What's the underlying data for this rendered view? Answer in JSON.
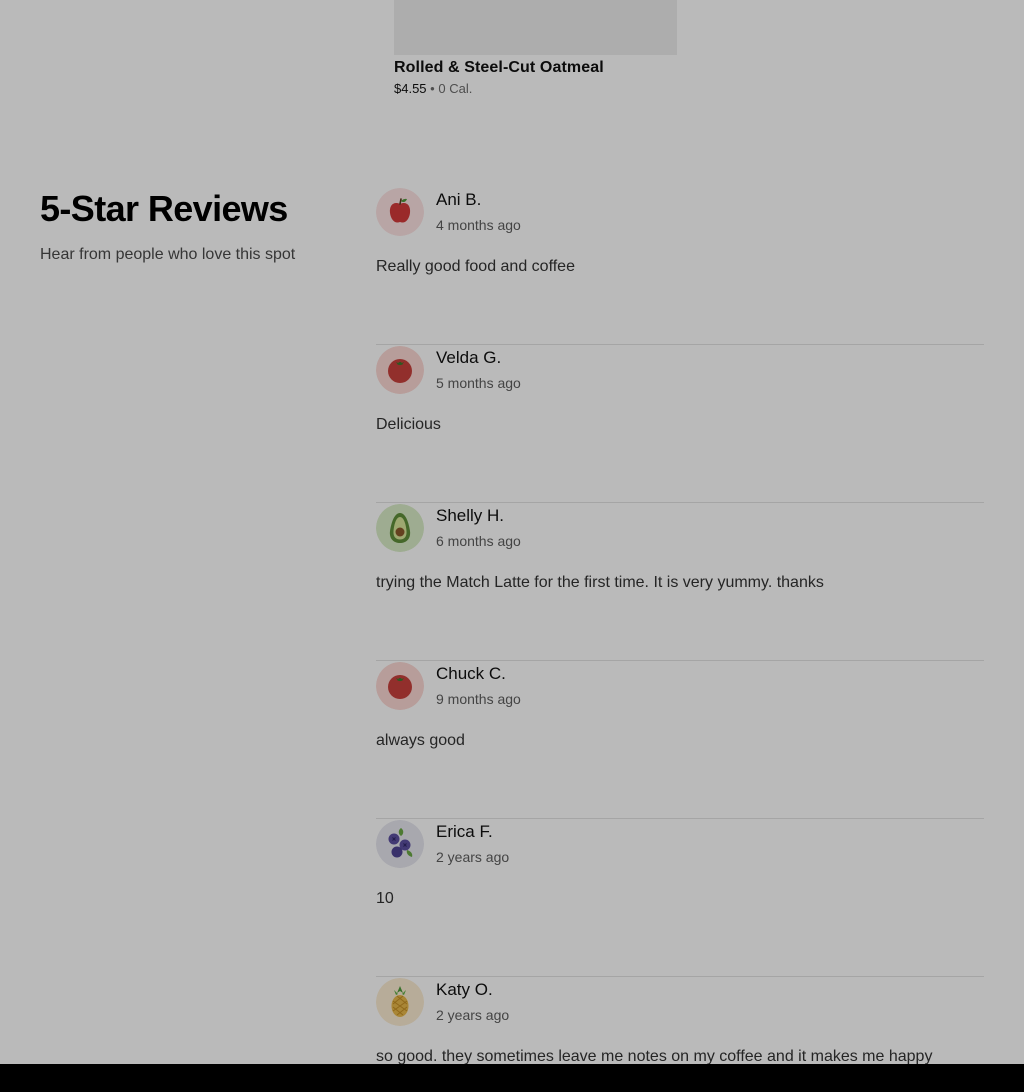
{
  "menu_item": {
    "name": "Rolled & Steel-Cut Oatmeal",
    "price": "$4.55",
    "separator": "•",
    "calories": "0 Cal."
  },
  "reviews_section": {
    "heading": "5-Star Reviews",
    "subheading": "Hear from people who love this spot"
  },
  "reviews": [
    {
      "name": "Ani B.",
      "date": "4 months ago",
      "text": "Really good food and coffee",
      "avatar_icon": "apple-icon"
    },
    {
      "name": "Velda G.",
      "date": "5 months ago",
      "text": "Delicious",
      "avatar_icon": "tomato-icon"
    },
    {
      "name": "Shelly H.",
      "date": "6 months ago",
      "text": "trying the Match Latte for the first time. It is very yummy. thanks",
      "avatar_icon": "avocado-icon"
    },
    {
      "name": "Chuck C.",
      "date": "9 months ago",
      "text": "always good",
      "avatar_icon": "tomato-icon"
    },
    {
      "name": "Erica F.",
      "date": "2 years ago",
      "text": "10",
      "avatar_icon": "blueberries-icon"
    },
    {
      "name": "Katy O.",
      "date": "2 years ago",
      "text": "so good. they sometimes leave me notes on my coffee and it makes me happy",
      "avatar_icon": "pineapple-icon"
    }
  ],
  "colors": {
    "overlay": "#000000",
    "apple": "#d33a3a",
    "tomato": "#c9413d",
    "avocado": "#5f8f3a",
    "blueberry": "#5b4fa0",
    "pineapple": "#e8b84a"
  }
}
